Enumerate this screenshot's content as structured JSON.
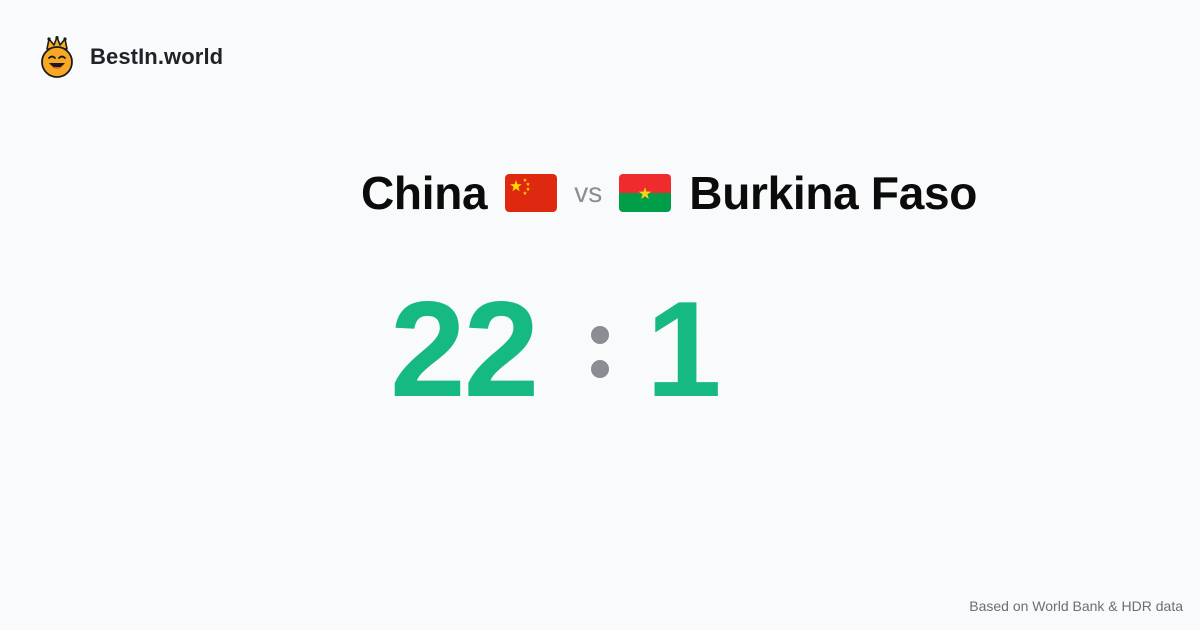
{
  "brand": {
    "logo_icon": "crown-smiley-icon",
    "name": "BestIn.world"
  },
  "comparison": {
    "left_country": "China",
    "left_flag_icon": "flag-china-icon",
    "vs_label": "vs",
    "right_country": "Burkina Faso",
    "right_flag_icon": "flag-burkina-faso-icon",
    "left_score": "22",
    "right_score": "1",
    "separator_icon": "colon-icon"
  },
  "footer": {
    "source": "Based on World Bank & HDR data"
  },
  "colors": {
    "background": "#f9fafb",
    "score": "#16b981",
    "muted": "#8a8d91",
    "text": "#0b0b0b"
  }
}
